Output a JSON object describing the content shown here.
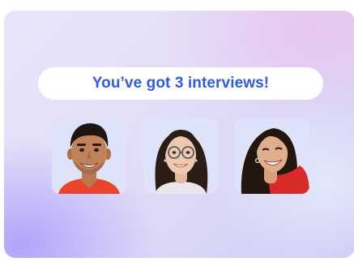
{
  "headline": {
    "text": "You’ve got 3 interviews!",
    "color": "#2f5be6"
  },
  "candidates": [
    {
      "icon": "man-portrait",
      "background": "#dfe3f9"
    },
    {
      "icon": "woman-glasses-portrait",
      "background": "#dfe3f9"
    },
    {
      "icon": "woman-smiling-portrait",
      "background": "#dfe3f9"
    }
  ],
  "colors": {
    "card_gradient": [
      "#e9e5f9",
      "#cfc9f8"
    ],
    "pill_background": "#ffffff"
  }
}
